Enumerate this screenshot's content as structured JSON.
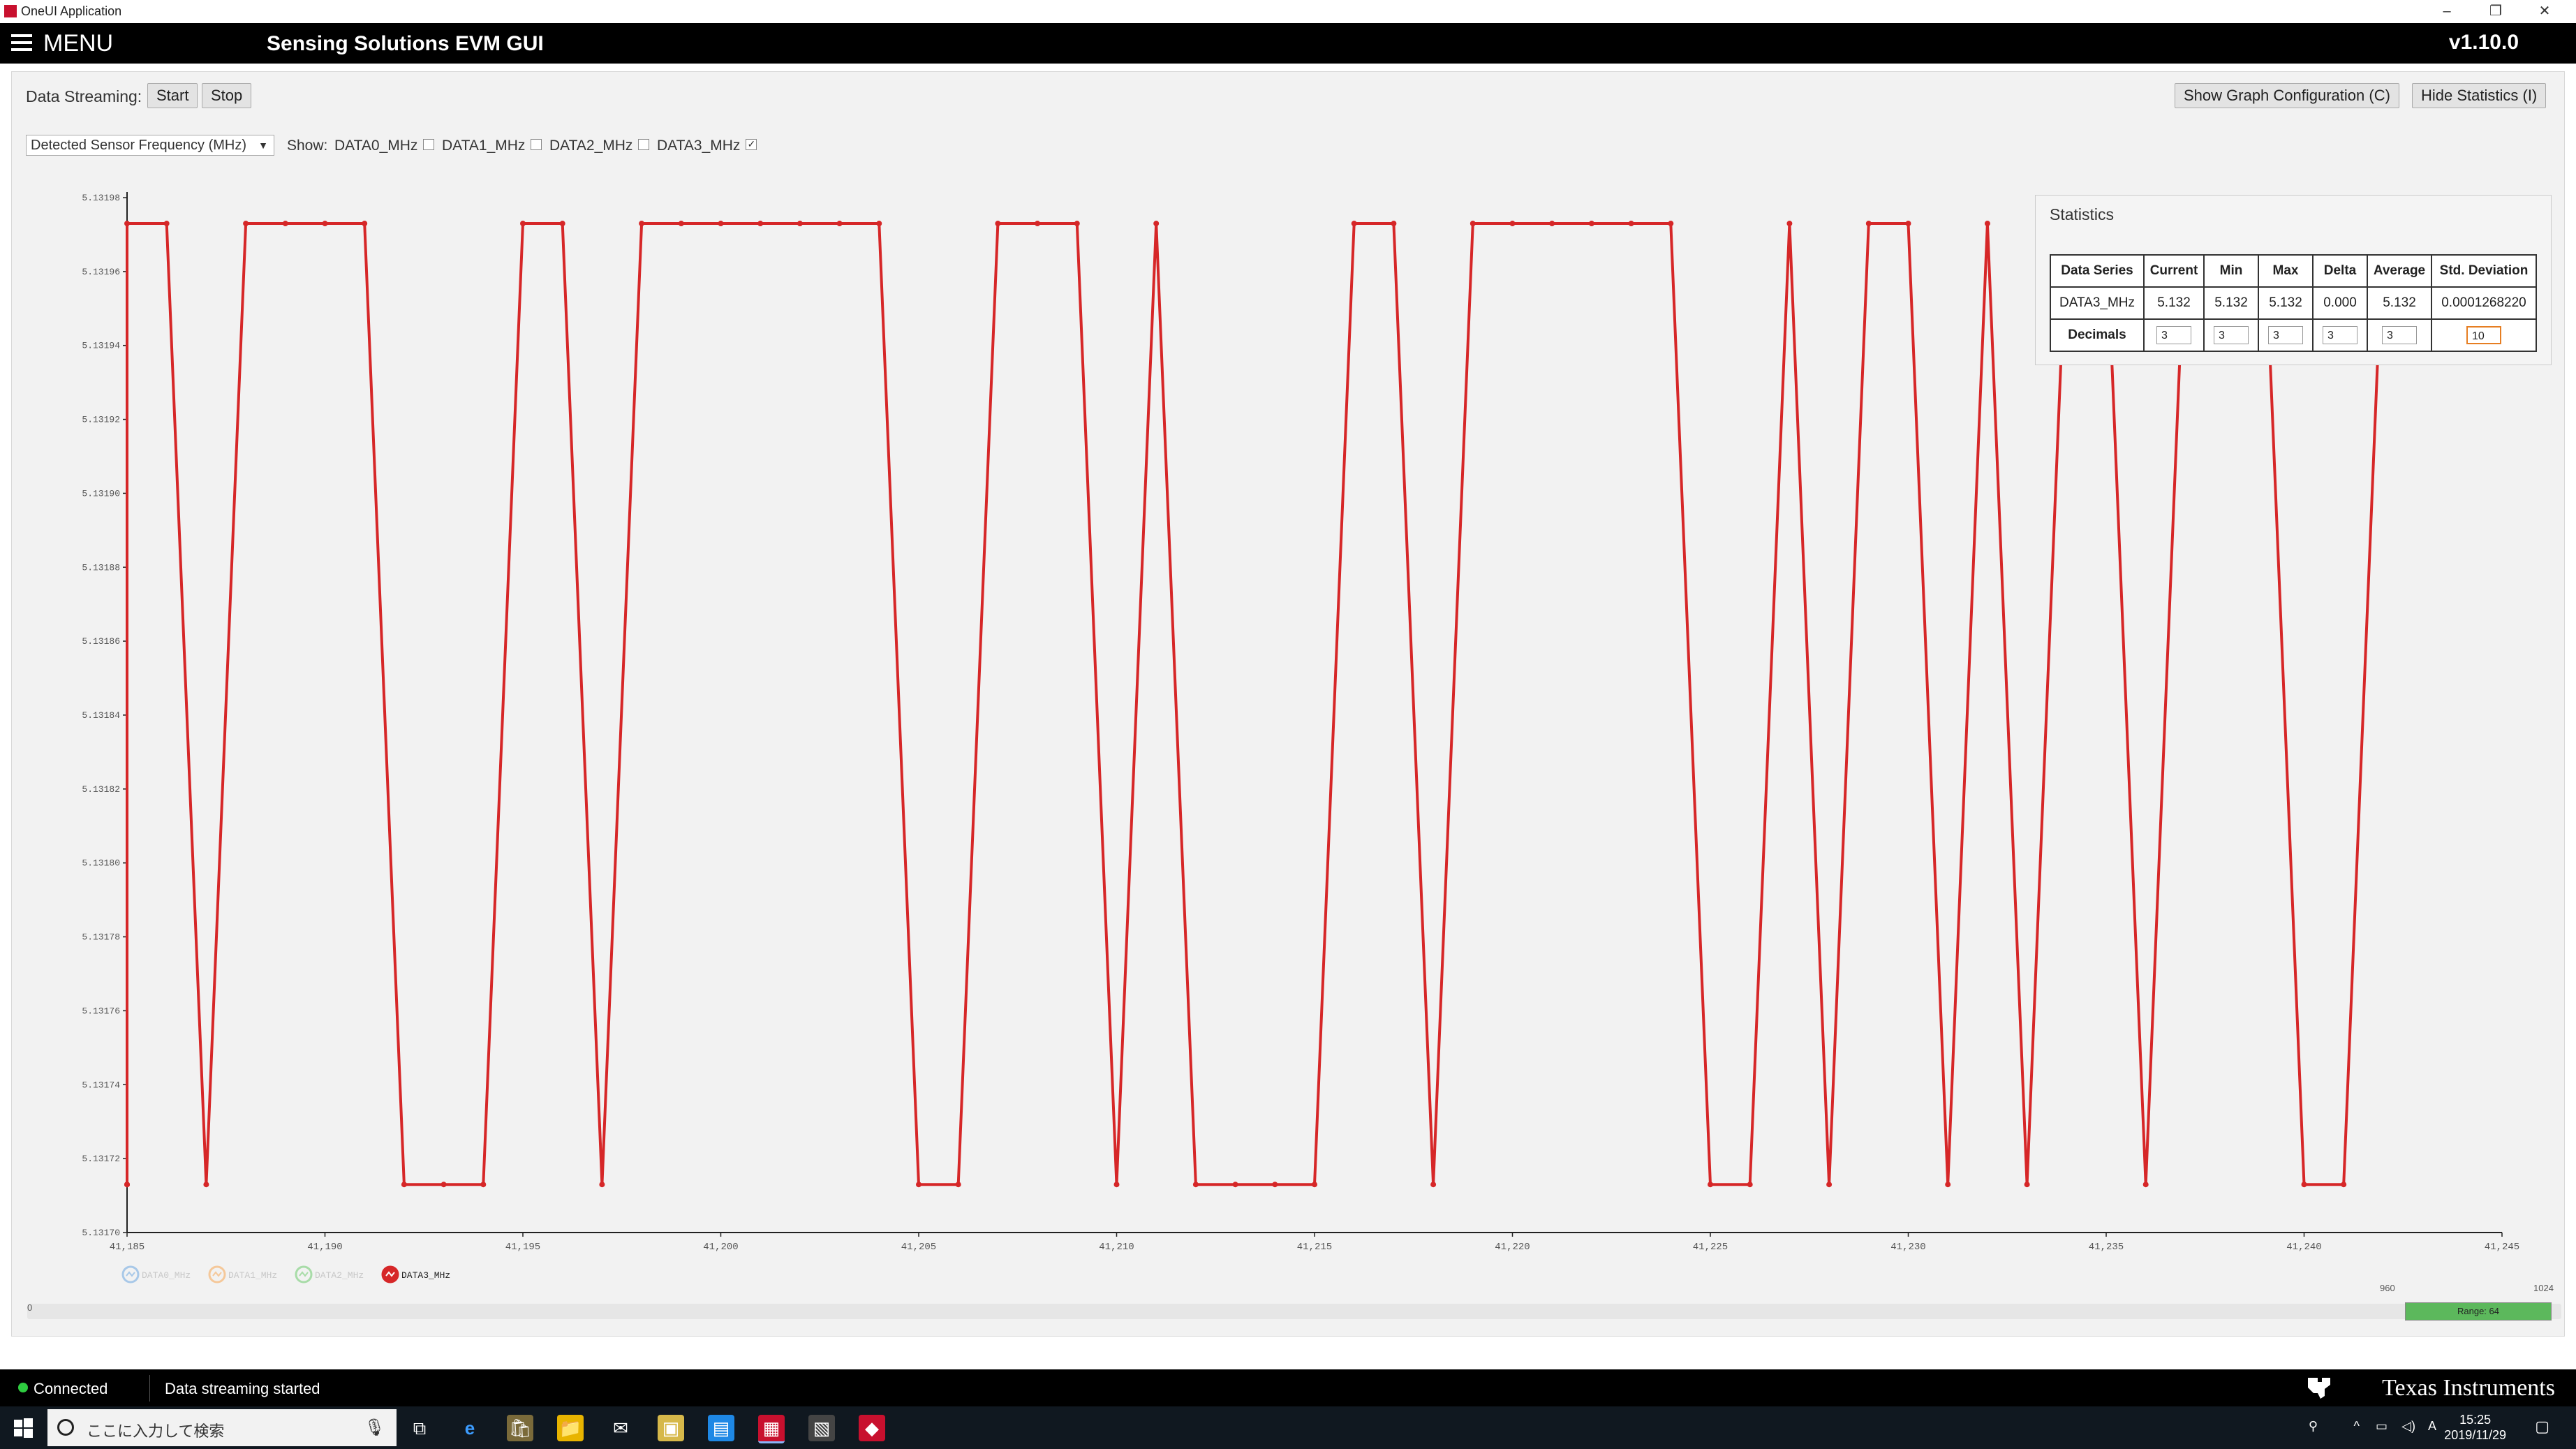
{
  "window": {
    "title": "OneUI Application",
    "controls": [
      "–",
      "❐",
      "✕"
    ]
  },
  "header": {
    "menu_label": "MENU",
    "app_title": "Sensing Solutions EVM GUI",
    "version": "v1.10.0"
  },
  "toolbar": {
    "streaming_label": "Data Streaming:",
    "start_label": "Start",
    "stop_label": "Stop",
    "graph_config_label": "Show Graph Configuration (C)",
    "hide_stats_label": "Hide Statistics (I)"
  },
  "graph_controls": {
    "selected_measurement": "Detected Sensor Frequency (MHz)",
    "show_label": "Show:",
    "channels": [
      {
        "label": "DATA0_MHz",
        "checked": false
      },
      {
        "label": "DATA1_MHz",
        "checked": false
      },
      {
        "label": "DATA2_MHz",
        "checked": false
      },
      {
        "label": "DATA3_MHz",
        "checked": true
      }
    ]
  },
  "statistics": {
    "title": "Statistics",
    "headers": [
      "Data Series",
      "Current",
      "Min",
      "Max",
      "Delta",
      "Average",
      "Std. Deviation"
    ],
    "row": [
      "DATA3_MHz",
      "5.132",
      "5.132",
      "5.132",
      "0.000",
      "5.132",
      "0.0001268220"
    ],
    "decimals_label": "Decimals",
    "decimals": [
      "3",
      "3",
      "3",
      "3",
      "3",
      "10"
    ]
  },
  "chart_data": {
    "type": "line",
    "xlim": [
      41185,
      41245
    ],
    "ylim": [
      5.1317,
      5.13198
    ],
    "x_ticks": [
      "41,185",
      "41,190",
      "41,195",
      "41,200",
      "41,205",
      "41,210",
      "41,215",
      "41,220",
      "41,225",
      "41,230",
      "41,235",
      "41,240",
      "41,245"
    ],
    "y_ticks": [
      "5.13170",
      "5.13172",
      "5.13174",
      "5.13176",
      "5.13178",
      "5.13180",
      "5.13182",
      "5.13184",
      "5.13186",
      "5.13188",
      "5.13190",
      "5.13192",
      "5.13194",
      "5.13196",
      "5.13198"
    ],
    "legend": [
      {
        "name": "DATA0_MHz",
        "active": false,
        "color": "#a8c8e8"
      },
      {
        "name": "DATA1_MHz",
        "active": false,
        "color": "#f5c89a"
      },
      {
        "name": "DATA2_MHz",
        "active": false,
        "color": "#a8dca8"
      },
      {
        "name": "DATA3_MHz",
        "active": true,
        "color": "#d62728"
      }
    ],
    "series": [
      {
        "name": "DATA3_MHz",
        "color": "#d62728",
        "start_x": 41182,
        "values": [
          5.131713,
          5.131713,
          5.131713,
          5.131973,
          5.131973,
          5.131713,
          5.131973,
          5.131973,
          5.131973,
          5.131973,
          5.131713,
          5.131713,
          5.131713,
          5.131973,
          5.131973,
          5.131713,
          5.131973,
          5.131973,
          5.131973,
          5.131973,
          5.131973,
          5.131973,
          5.131973,
          5.131713,
          5.131713,
          5.131973,
          5.131973,
          5.131973,
          5.131713,
          5.131973,
          5.131713,
          5.131713,
          5.131713,
          5.131713,
          5.131973,
          5.131973,
          5.131713,
          5.131973,
          5.131973,
          5.131973,
          5.131973,
          5.131973,
          5.131973,
          5.131713,
          5.131713,
          5.131973,
          5.131713,
          5.131973,
          5.131973,
          5.131713,
          5.131973,
          5.131713,
          5.131973,
          5.131973,
          5.131713,
          5.131973,
          5.131973,
          5.131973,
          5.131713,
          5.131713,
          5.131973,
          5.131973,
          5.131973,
          5.131973
        ]
      }
    ]
  },
  "range": {
    "min_label": "0",
    "low_label": "960",
    "high_label": "1024",
    "range_text": "Range: 64"
  },
  "status": {
    "connection": "Connected",
    "message": "Data streaming started",
    "brand": "Texas Instruments"
  },
  "taskbar": {
    "search_placeholder": "ここに入力して検索",
    "time": "15:25",
    "date": "2019/11/29",
    "ime": "A"
  }
}
